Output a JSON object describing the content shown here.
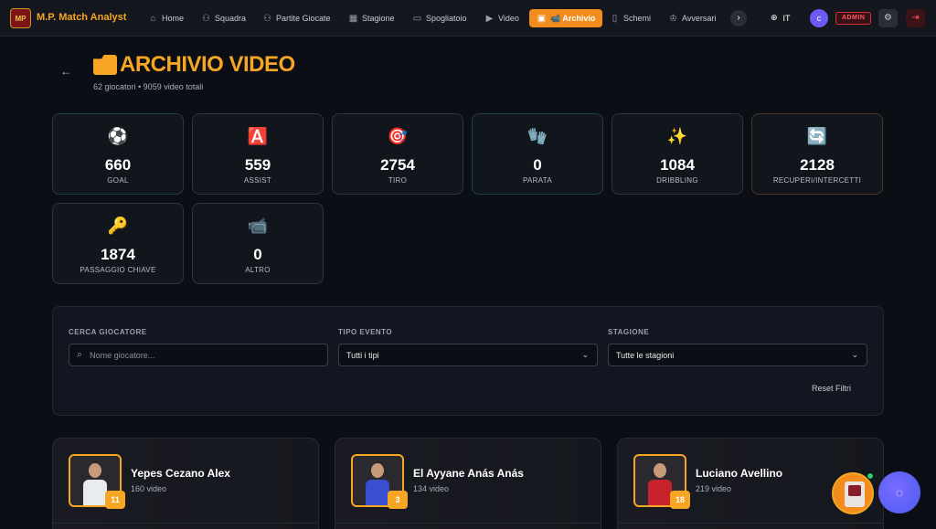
{
  "brand": {
    "logo_text": "MP",
    "name": "M.P. Match Analyst"
  },
  "nav": {
    "items": [
      {
        "label": "Home",
        "icon": "home-icon",
        "glyph": "⌂"
      },
      {
        "label": "Squadra",
        "icon": "users-icon",
        "glyph": "⚇"
      },
      {
        "label": "Partite Giocate",
        "icon": "people-icon",
        "glyph": "⚇"
      },
      {
        "label": "Stagione",
        "icon": "calendar-icon",
        "glyph": "▦"
      },
      {
        "label": "Spogliatoio",
        "icon": "chat-icon",
        "glyph": "▭"
      },
      {
        "label": "Video",
        "icon": "video-icon",
        "glyph": "▶"
      },
      {
        "label": "📹 Archivio",
        "icon": "archive-icon",
        "glyph": "▣",
        "active": true
      },
      {
        "label": "Schemi",
        "icon": "book-icon",
        "glyph": "▯"
      },
      {
        "label": "Avversari",
        "icon": "trophy-icon",
        "glyph": "♔"
      }
    ],
    "more_glyph": "›",
    "language": "IT",
    "language_glyph": "⊕",
    "user_initial": "c",
    "role_badge": "ADMIN",
    "settings_glyph": "⚙",
    "logout_glyph": "⇥"
  },
  "header": {
    "back_glyph": "←",
    "title": "ARCHIVIO VIDEO",
    "subtitle": "62 giocatori • 9059 video totali"
  },
  "stats": [
    {
      "emoji": "⚽",
      "value": "660",
      "label": "GOAL"
    },
    {
      "emoji": "🅰️",
      "value": "559",
      "label": "ASSIST"
    },
    {
      "emoji": "🎯",
      "value": "2754",
      "label": "TIRO"
    },
    {
      "emoji": "🧤",
      "value": "0",
      "label": "PARATA"
    },
    {
      "emoji": "✨",
      "value": "1084",
      "label": "DRIBBLING"
    },
    {
      "emoji": "🔄",
      "value": "2128",
      "label": "RECUPERI/INTERCETTI"
    },
    {
      "emoji": "🔑",
      "value": "1874",
      "label": "PASSAGGIO CHIAVE"
    },
    {
      "emoji": "📹",
      "value": "0",
      "label": "ALTRO"
    }
  ],
  "filters": {
    "player_label": "CERCA GIOCATORE",
    "player_placeholder": "Nome giocatore...",
    "search_glyph": "⌕",
    "type_label": "TIPO EVENTO",
    "type_value": "Tutti i tipi",
    "season_label": "STAGIONE",
    "season_value": "Tutte le stagioni",
    "chevron_glyph": "⌄",
    "reset_label": "Reset Filtri"
  },
  "players": [
    {
      "name": "Yepes Cezano Alex",
      "videos": "160 video",
      "number": "11",
      "kit_color": "#e9ecef"
    },
    {
      "name": "El Ayyane Anás Anás",
      "videos": "134 video",
      "number": "3",
      "kit_color": "#3a4fd0"
    },
    {
      "name": "Luciano Avellino",
      "videos": "219 video",
      "number": "18",
      "kit_color": "#c8232c"
    }
  ],
  "fab": {
    "chat_glyph": "◌"
  }
}
